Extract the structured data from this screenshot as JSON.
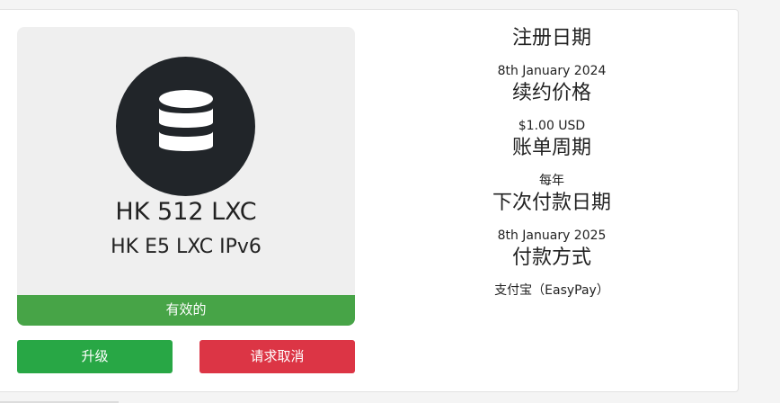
{
  "product": {
    "icon": "database-icon",
    "name": "HK 512 LXC",
    "group": "HK E5 LXC IPv6",
    "status": "有效的",
    "status_color": "#47a447"
  },
  "actions": {
    "upgrade_label": "升级",
    "cancel_label": "请求取消",
    "upgrade_color": "#28a745",
    "cancel_color": "#dc3545"
  },
  "details": [
    {
      "label": "注册日期",
      "value": "8th January 2024"
    },
    {
      "label": "续约价格",
      "value": "$1.00 USD"
    },
    {
      "label": "账单周期",
      "value": "每年"
    },
    {
      "label": "下次付款日期",
      "value": "8th January 2025"
    },
    {
      "label": "付款方式",
      "value": "支付宝（EasyPay）"
    }
  ]
}
